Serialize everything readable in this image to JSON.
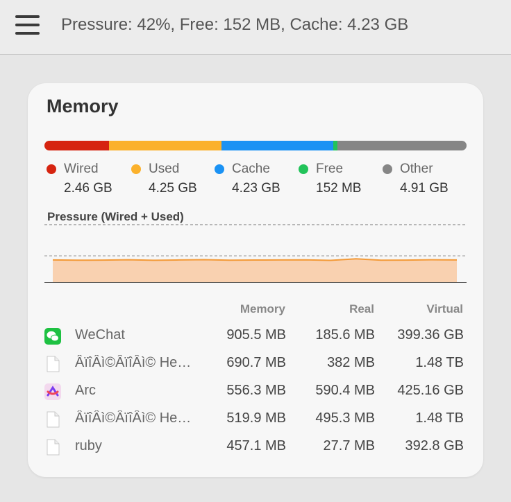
{
  "header": {
    "summary": "Pressure: 42%, Free: 152 MB, Cache: 4.23 GB",
    "menu_icon": "hamburger-menu-icon"
  },
  "card": {
    "title": "Memory"
  },
  "memory_bar": [
    {
      "label": "Wired",
      "value": "2.46 GB",
      "gb": 2.46,
      "color": "#d62410"
    },
    {
      "label": "Used",
      "value": "4.25 GB",
      "gb": 4.25,
      "color": "#fbb12c"
    },
    {
      "label": "Cache",
      "value": "4.23 GB",
      "gb": 4.23,
      "color": "#1a92f4"
    },
    {
      "label": "Free",
      "value": "152 MB",
      "gb": 0.152,
      "color": "#22c35a"
    },
    {
      "label": "Other",
      "value": "4.91 GB",
      "gb": 4.91,
      "color": "#868686"
    }
  ],
  "pressure": {
    "label": "Pressure (Wired + Used)",
    "level_percent": 42,
    "fill_color": "#f9d1b0",
    "line_color": "#f39a37"
  },
  "table": {
    "headers": {
      "memory": "Memory",
      "real": "Real",
      "virtual": "Virtual"
    },
    "rows": [
      {
        "name": "WeChat",
        "icon": "wechat-icon",
        "memory": "905.5 MB",
        "real": "185.6 MB",
        "virtual": "399.36 GB"
      },
      {
        "name": "ÂïîÂì©ÂïîÂì© He…",
        "icon": "document-icon",
        "memory": "690.7 MB",
        "real": "382 MB",
        "virtual": "1.48 TB"
      },
      {
        "name": "Arc",
        "icon": "arc-icon",
        "memory": "556.3 MB",
        "real": "590.4 MB",
        "virtual": "425.16 GB"
      },
      {
        "name": "ÂïîÂì©ÂïîÂì© He…",
        "icon": "document-icon",
        "memory": "519.9 MB",
        "real": "495.3 MB",
        "virtual": "1.48 TB"
      },
      {
        "name": "ruby",
        "icon": "document-icon",
        "memory": "457.1 MB",
        "real": "27.7 MB",
        "virtual": "392.8 GB"
      }
    ]
  }
}
